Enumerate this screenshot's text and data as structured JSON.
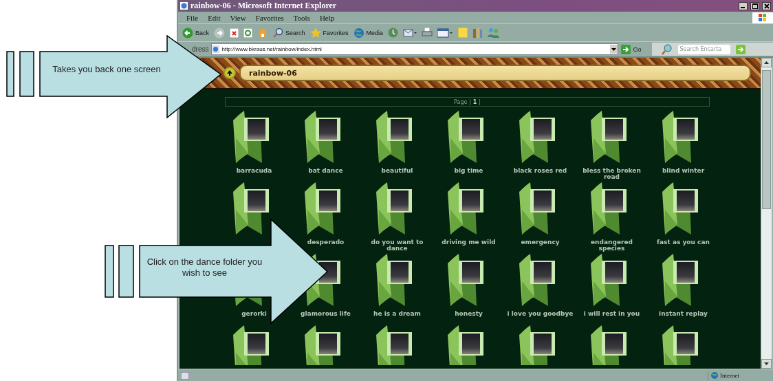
{
  "window": {
    "title": "rainbow-06 - Microsoft Internet Explorer"
  },
  "menus": [
    {
      "label": "File"
    },
    {
      "label": "Edit"
    },
    {
      "label": "View"
    },
    {
      "label": "Favorites"
    },
    {
      "label": "Tools"
    },
    {
      "label": "Help"
    }
  ],
  "toolbar": [
    {
      "kind": "back",
      "label": "Back"
    },
    {
      "kind": "forward"
    },
    {
      "kind": "stop"
    },
    {
      "kind": "refresh"
    },
    {
      "kind": "home"
    },
    {
      "kind": "search",
      "label": "Search"
    },
    {
      "kind": "favorites",
      "label": "Favorites"
    },
    {
      "kind": "media",
      "label": "Media"
    },
    {
      "kind": "history"
    },
    {
      "kind": "mail"
    },
    {
      "kind": "print"
    },
    {
      "kind": "edit"
    },
    {
      "kind": "note"
    },
    {
      "kind": "research"
    },
    {
      "kind": "messenger"
    }
  ],
  "address": {
    "label": "dress",
    "value": "http://www.bkraus.net/rainbow/index.html",
    "go": "Go"
  },
  "encarta": {
    "placeholder": "Search Encarta"
  },
  "page": {
    "title": "rainbow-06",
    "pager": {
      "prefix": "Page |",
      "current": "1",
      "suffix": "|"
    }
  },
  "folders": [
    {
      "kind": "labeled",
      "label": "barracuda"
    },
    {
      "kind": "labeled",
      "label": "bat dance"
    },
    {
      "kind": "labeled",
      "label": "beautiful"
    },
    {
      "kind": "labeled",
      "label": "big time"
    },
    {
      "kind": "labeled",
      "label": "black roses red"
    },
    {
      "kind": "labeled",
      "label": "bless the broken road"
    },
    {
      "kind": "labeled",
      "label": "blind winter"
    },
    {
      "kind": "unlabeled"
    },
    {
      "kind": "labeled",
      "label": "desperado"
    },
    {
      "kind": "labeled",
      "label": "do you want to dance"
    },
    {
      "kind": "labeled",
      "label": "driving me wild"
    },
    {
      "kind": "labeled",
      "label": "emergency"
    },
    {
      "kind": "labeled",
      "label": "endangered species"
    },
    {
      "kind": "labeled",
      "label": "fast as you can"
    },
    {
      "kind": "labeled",
      "label": "gerorki"
    },
    {
      "kind": "labeled",
      "label": "glamorous life"
    },
    {
      "kind": "labeled",
      "label": "he is a dream"
    },
    {
      "kind": "labeled",
      "label": "honesty"
    },
    {
      "kind": "labeled",
      "label": "i love you goodbye"
    },
    {
      "kind": "labeled",
      "label": "i will rest in you"
    },
    {
      "kind": "labeled",
      "label": "instant replay"
    },
    {
      "kind": "cut"
    },
    {
      "kind": "cut"
    },
    {
      "kind": "cut"
    },
    {
      "kind": "cut"
    },
    {
      "kind": "cut"
    },
    {
      "kind": "cut"
    },
    {
      "kind": "cut"
    }
  ],
  "status": {
    "zone": "Internet"
  },
  "callouts": [
    {
      "text": "Takes you back one screen"
    },
    {
      "text": "Click on the dance folder you wish to see"
    }
  ]
}
